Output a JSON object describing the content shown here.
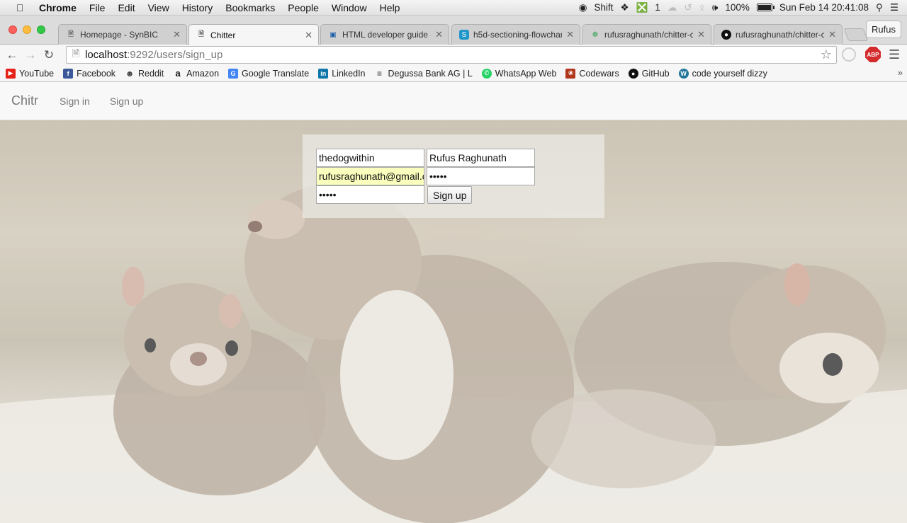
{
  "menubar": {
    "app": "Chrome",
    "items": [
      "File",
      "Edit",
      "View",
      "History",
      "Bookmarks",
      "People",
      "Window",
      "Help"
    ],
    "status": {
      "input_source": "Shift",
      "notifications_count": "1",
      "battery": "100%",
      "clock": "Sun Feb 14  20:41:08"
    }
  },
  "tabs": [
    {
      "label": "Homepage - SynBIC",
      "icon": "page-icon"
    },
    {
      "label": "Chitter",
      "icon": "page-icon"
    },
    {
      "label": "HTML developer guide - ",
      "icon": "guide-icon"
    },
    {
      "label": "h5d-sectioning-flowchar",
      "icon": "s-icon"
    },
    {
      "label": "rufusraghunath/chitter-c",
      "icon": "circle-icon"
    },
    {
      "label": "rufusraghunath/chitter-c",
      "icon": "github-icon"
    }
  ],
  "profile": "Rufus",
  "address": {
    "host": "localhost",
    "path": ":9292/users/sign_up"
  },
  "bookmarks": [
    {
      "label": "YouTube",
      "icon": "youtube-icon",
      "color": "#e62117"
    },
    {
      "label": "Facebook",
      "icon": "facebook-icon",
      "color": "#3b5998"
    },
    {
      "label": "Reddit",
      "icon": "reddit-icon",
      "color": "#555555"
    },
    {
      "label": "Amazon",
      "icon": "amazon-icon",
      "color": "#222222"
    },
    {
      "label": "Google Translate",
      "icon": "translate-icon",
      "color": "#4285f4"
    },
    {
      "label": "LinkedIn",
      "icon": "linkedin-icon",
      "color": "#0e76a8"
    },
    {
      "label": "Degussa Bank AG | L",
      "icon": "degussa-icon",
      "color": "#333333"
    },
    {
      "label": "WhatsApp Web",
      "icon": "whatsapp-icon",
      "color": "#25d366"
    },
    {
      "label": "Codewars",
      "icon": "codewars-icon",
      "color": "#b1361e"
    },
    {
      "label": "GitHub",
      "icon": "github-icon",
      "color": "#111111"
    },
    {
      "label": "code yourself dizzy",
      "icon": "wordpress-icon",
      "color": "#21759b"
    }
  ],
  "site": {
    "brand": "Chitr",
    "nav": [
      "Sign in",
      "Sign up"
    ]
  },
  "signup_form": {
    "username": "thedogwithin",
    "name": "Rufus Raghunath",
    "email": "rufusraghunath@gmail.com",
    "password": "•••••",
    "password_confirmation": "•••••",
    "submit": "Sign up"
  }
}
